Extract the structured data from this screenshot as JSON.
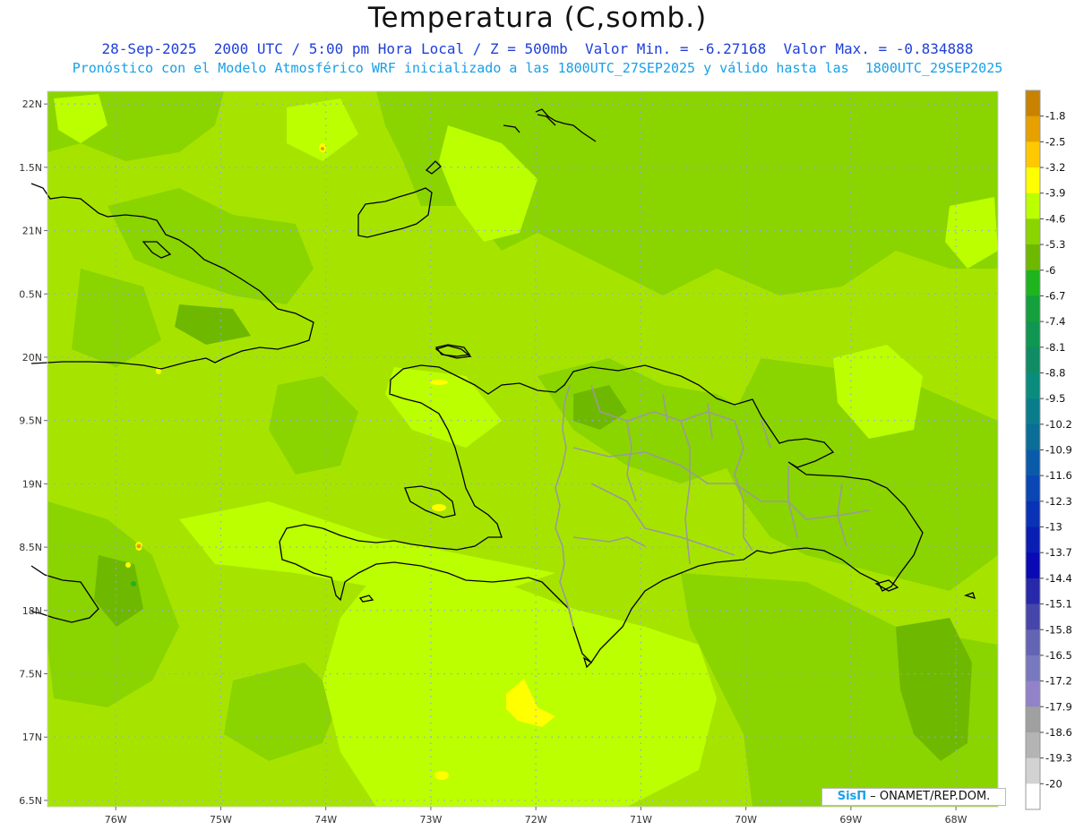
{
  "title": "Temperatura (C,somb.)",
  "subtitle_line1": "28-Sep-2025  2000 UTC / 5:00 pm Hora Local / Z = 500mb  Valor Min. = -6.27168  Valor Max. = -0.834888",
  "subtitle_line2": "Pronóstico con el Modelo Atmosférico WRF inicializado a las 1800UTC_27SEP2025 y válido hasta las  1800UTC_29SEP2025",
  "map": {
    "lon_range": [
      -76.65,
      -67.6
    ],
    "lat_range": [
      16.45,
      22.1
    ],
    "lat_ticks": [
      "22N",
      "1.5N",
      "21N",
      "0.5N",
      "20N",
      "9.5N",
      "19N",
      "8.5N",
      "18N",
      "7.5N",
      "17N",
      "6.5N"
    ],
    "lat_values": [
      22,
      21.5,
      21,
      20.5,
      20,
      19.5,
      19,
      18.5,
      18,
      17.5,
      17,
      16.5
    ],
    "lon_ticks": [
      "76W",
      "75W",
      "74W",
      "73W",
      "72W",
      "71W",
      "70W",
      "69W",
      "68W"
    ],
    "lon_values": [
      -76,
      -75,
      -74,
      -73,
      -72,
      -71,
      -70,
      -69,
      -68
    ],
    "grid_color": "#9a9aff",
    "background_color": "#a6e400",
    "shade_colors": {
      "range_-5.3_-4.6": "#a6e400",
      "range_-6_-5.3": "#8ad400",
      "range_-6.7_-6": "#6fb800",
      "range_-4.6_-3.9": "#bcff00",
      "range_-3.9_-3.2": "#ffff00"
    }
  },
  "colorbar": {
    "labels": [
      "-1.8",
      "-2.5",
      "-3.2",
      "-3.9",
      "-4.6",
      "-5.3",
      "-6",
      "-6.7",
      "-7.4",
      "-8.1",
      "-8.8",
      "-9.5",
      "-10.2",
      "-10.9",
      "-11.6",
      "-12.3",
      "-13",
      "-13.7",
      "-14.4",
      "-15.1",
      "-15.8",
      "-16.5",
      "-17.2",
      "-17.9",
      "-18.6",
      "-19.3",
      "-20"
    ],
    "colors": [
      "#c88200",
      "#e6a000",
      "#ffc800",
      "#ffff00",
      "#bcff00",
      "#8ad400",
      "#6fb800",
      "#1eb41e",
      "#14a03c",
      "#0f9650",
      "#0f8c64",
      "#0a8c7d",
      "#0a7d8c",
      "#0a6e96",
      "#0a5aaa",
      "#0a46b4",
      "#0a32b4",
      "#0a1eb4",
      "#0a0ab4",
      "#2828aa",
      "#4646aa",
      "#6464b4",
      "#7878be",
      "#9282c8",
      "#a0a0a0",
      "#b4b4b4",
      "#d2d2d2",
      "#ffffff"
    ]
  },
  "credit": {
    "brand": "SisΠ",
    "text": " – ONAMET/REP.DOM."
  }
}
